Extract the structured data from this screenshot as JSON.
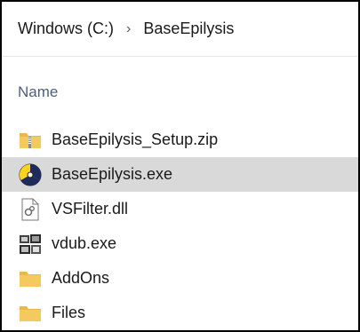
{
  "address": {
    "drive": "Windows (C:)",
    "separator": "›",
    "folder": "BaseEpilysis"
  },
  "header": {
    "name_label": "Name"
  },
  "files": [
    {
      "name": "BaseEpilysis_Setup.zip",
      "icon": "zip-folder-icon"
    },
    {
      "name": "BaseEpilysis.exe",
      "icon": "app-exe-icon",
      "selected": true
    },
    {
      "name": "VSFilter.dll",
      "icon": "dll-file-icon"
    },
    {
      "name": "vdub.exe",
      "icon": "exe-app-icon"
    },
    {
      "name": "AddOns",
      "icon": "folder-icon"
    },
    {
      "name": "Files",
      "icon": "folder-icon"
    }
  ],
  "colors": {
    "selection": "#d9d9d9",
    "folder": "#f4c95d",
    "header_text": "#4c607a"
  }
}
